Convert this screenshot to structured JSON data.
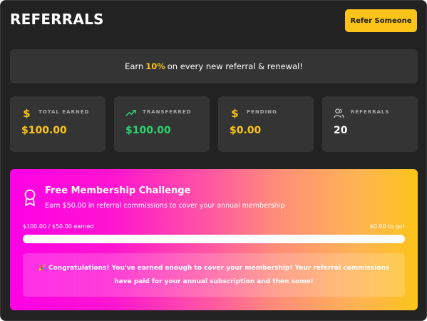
{
  "header": {
    "title": "REFERRALS",
    "refer_button_label": "Refer Someone"
  },
  "earn_banner": {
    "prefix": "Earn",
    "rate": "10%",
    "suffix": "on every new referral & renewal!"
  },
  "stats": [
    {
      "label": "TOTAL EARNED",
      "value": "$100.00",
      "icon": "dollar-icon",
      "value_color": "#fcc419"
    },
    {
      "label": "TRANSFERRED",
      "value": "$100.00",
      "icon": "trending-up-icon",
      "value_color": "#2bd46e"
    },
    {
      "label": "PENDING",
      "value": "$0.00",
      "icon": "dollar-icon",
      "value_color": "#fcc419"
    },
    {
      "label": "REFERRALS",
      "value": "20",
      "icon": "users-icon",
      "value_color": "#ffffff"
    }
  ],
  "challenge": {
    "title": "Free Membership Challenge",
    "subtitle": "Earn $50.00 in referral commissions to cover your annual membership",
    "progress_label": "$100.00 / $50.00 earned",
    "remaining_label": "$0.00 to go!",
    "progress_fraction": 1.0,
    "congrats_message": "🎉 Congratulations! You've earned enough to cover your membership! Your referral commissions have paid for your annual subscription and then some!"
  },
  "colors": {
    "accent": "#fcc419",
    "green": "#2bd46e",
    "background": "#222222",
    "card": "#343434"
  }
}
